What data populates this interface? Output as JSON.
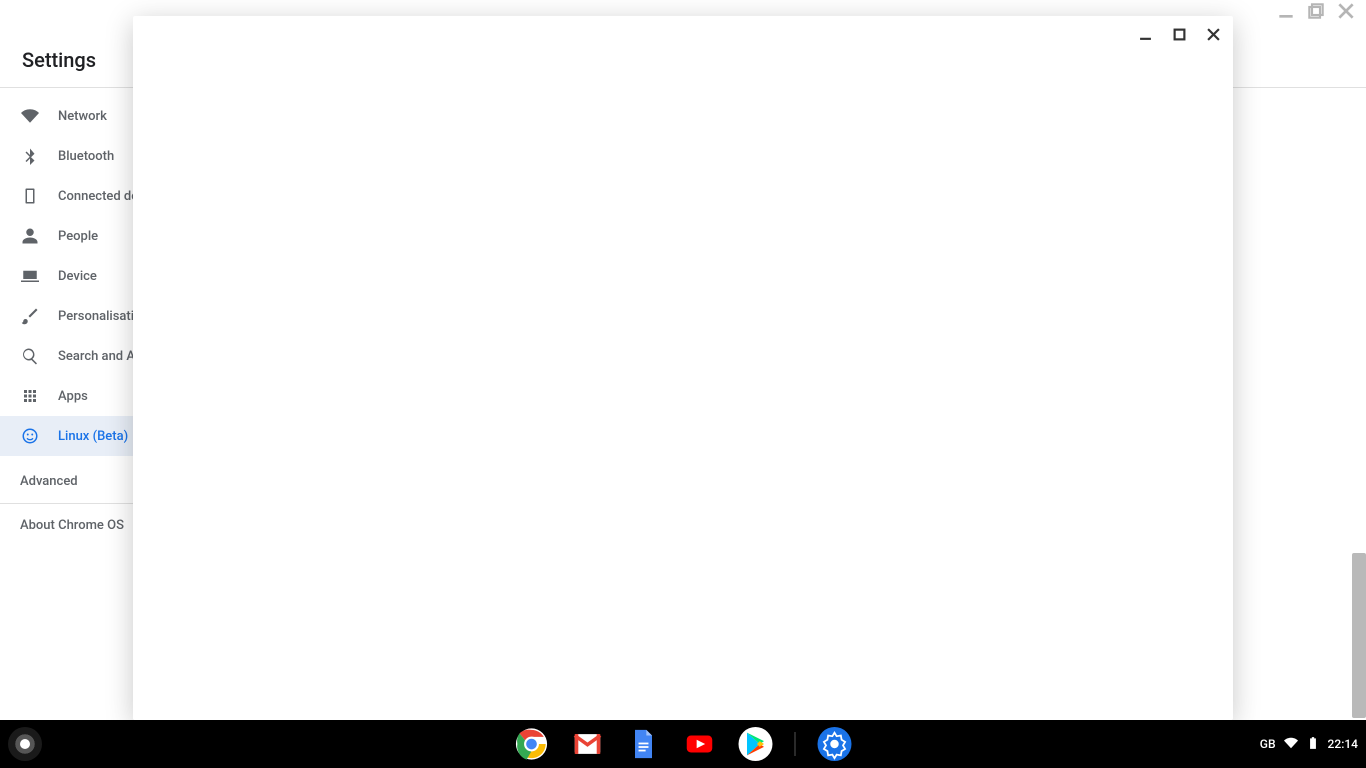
{
  "settings": {
    "title": "Settings",
    "items": [
      {
        "id": "network",
        "label": "Network"
      },
      {
        "id": "bluetooth",
        "label": "Bluetooth"
      },
      {
        "id": "connected",
        "label": "Connected devices"
      },
      {
        "id": "people",
        "label": "People"
      },
      {
        "id": "device",
        "label": "Device"
      },
      {
        "id": "personalisation",
        "label": "Personalisation"
      },
      {
        "id": "search",
        "label": "Search and Assistant"
      },
      {
        "id": "apps",
        "label": "Apps"
      },
      {
        "id": "linux",
        "label": "Linux (Beta)"
      }
    ],
    "advanced": "Advanced",
    "about": "About Chrome OS"
  },
  "status": {
    "keyboard": "GB",
    "time": "22:14"
  },
  "shelf_apps": [
    "chrome",
    "gmail",
    "docs",
    "youtube",
    "play-store",
    "settings"
  ]
}
